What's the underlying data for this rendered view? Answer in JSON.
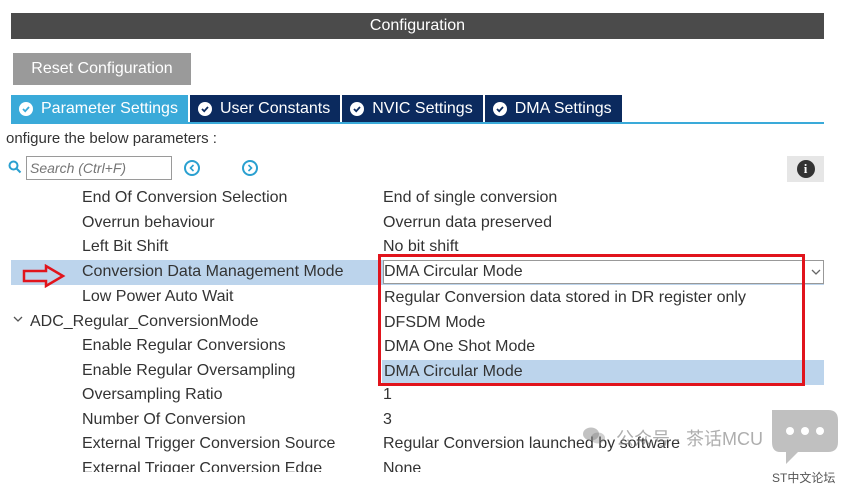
{
  "window": {
    "title": "Configuration"
  },
  "toolbar": {
    "reset_label": "Reset Configuration"
  },
  "tabs": [
    {
      "label": "Parameter Settings",
      "active": true
    },
    {
      "label": "User Constants",
      "active": false
    },
    {
      "label": "NVIC Settings",
      "active": false
    },
    {
      "label": "DMA Settings",
      "active": false
    }
  ],
  "hint": "onfigure the below parameters :",
  "search": {
    "placeholder": "Search (Ctrl+F)"
  },
  "params": {
    "eoc": {
      "name": "End Of Conversion Selection",
      "value": "End of single conversion"
    },
    "overrun": {
      "name": "Overrun behaviour",
      "value": "Overrun data preserved"
    },
    "leftshift": {
      "name": "Left Bit Shift",
      "value": "No bit shift"
    },
    "cdmm": {
      "name": "Conversion Data Management Mode",
      "value": "DMA Circular Mode"
    },
    "lpaw": {
      "name": "Low Power Auto Wait"
    },
    "group": {
      "name": "ADC_Regular_ConversionMode"
    },
    "erc": {
      "name": "Enable Regular Conversions"
    },
    "ero": {
      "name": "Enable Regular Oversampling"
    },
    "osr": {
      "name": "Oversampling Ratio",
      "value": "1"
    },
    "noc": {
      "name": "Number Of Conversion",
      "value": "3"
    },
    "etcs": {
      "name": "External Trigger Conversion Source",
      "value": "Regular Conversion launched by software"
    },
    "etce": {
      "name": "External Trigger Conversion Edge",
      "value": "None"
    }
  },
  "dropdown": {
    "options": [
      "Regular Conversion data stored in DR register only",
      "DFSDM Mode",
      "DMA One Shot Mode",
      "DMA Circular Mode"
    ],
    "selected_index": 3
  },
  "watermark": {
    "text": "公众号 · 茶话MCU",
    "badge": "ST中文论坛"
  },
  "colors": {
    "annotation_red": "#e1141c",
    "tab_active": "#3aaad9",
    "tab_inactive": "#0b2a5e",
    "selection": "#bcd4ec"
  }
}
